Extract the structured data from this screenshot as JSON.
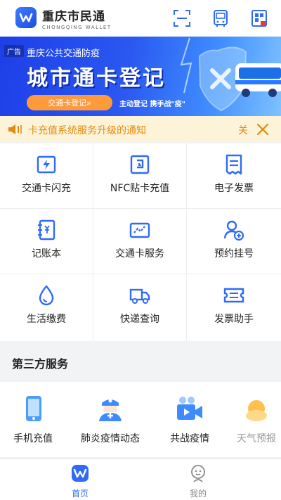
{
  "header": {
    "brand_cn": "重庆市民通",
    "brand_en": "CHONGQING WALLET",
    "icons": [
      "scan-icon",
      "bus-card-icon",
      "qr-pay-icon"
    ]
  },
  "banner": {
    "ad_tag": "广告",
    "subtitle": "重庆公共交通防疫",
    "title": "城市通卡登记",
    "button": "交通卡登记»",
    "note": "主动登记 携手战\"疫\""
  },
  "notice": {
    "text": "卡充值系统服务升级的通知",
    "tail": "关"
  },
  "services": [
    {
      "label": "交通卡闪充",
      "icon": "flash-charge-icon"
    },
    {
      "label": "NFC贴卡充值",
      "icon": "nfc-icon"
    },
    {
      "label": "电子发票",
      "icon": "e-invoice-icon"
    },
    {
      "label": "记账本",
      "icon": "ledger-icon"
    },
    {
      "label": "交通卡服务",
      "icon": "card-service-icon"
    },
    {
      "label": "预约挂号",
      "icon": "appointment-icon"
    },
    {
      "label": "生活缴费",
      "icon": "utility-payment-icon"
    },
    {
      "label": "快递查询",
      "icon": "delivery-truck-icon"
    },
    {
      "label": "发票助手",
      "icon": "invoice-assistant-icon"
    }
  ],
  "third_party": {
    "title": "第三方服务",
    "items": [
      {
        "label": "手机充值",
        "icon": "phone-recharge-icon"
      },
      {
        "label": "肺炎疫情动态",
        "icon": "doctor-icon"
      },
      {
        "label": "共战疫情",
        "icon": "video-icon"
      },
      {
        "label": "天气预报",
        "icon": "weather-icon"
      }
    ]
  },
  "tabbar": {
    "home": "首页",
    "mine": "我的"
  },
  "colors": {
    "accent": "#2f6bf5",
    "notice_text": "#e08a10",
    "notice_bg": "#fdf3d8",
    "banner_button": "#ff9a3c"
  }
}
